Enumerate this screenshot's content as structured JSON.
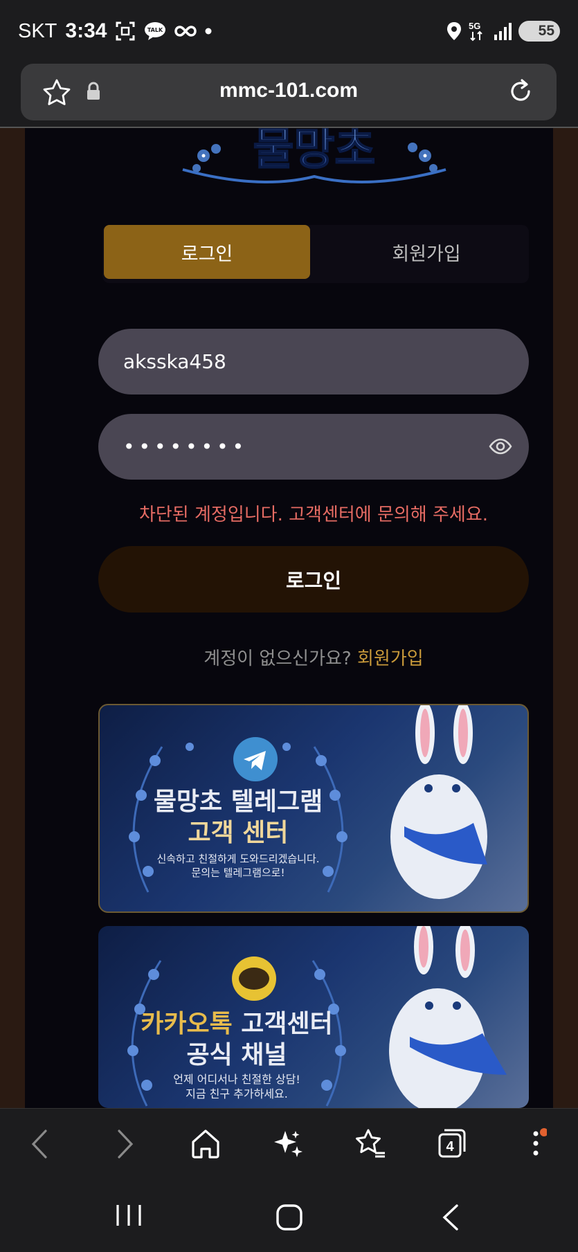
{
  "status_bar": {
    "carrier": "SKT",
    "time": "3:34",
    "network": "5G",
    "battery": "55"
  },
  "browser": {
    "url": "mmc-101.com",
    "tab_count": "4"
  },
  "page": {
    "logo_text": "물망초",
    "tabs": {
      "login": "로그인",
      "signup": "회원가입"
    },
    "username_value": "aksska458",
    "password_mask": "••••••••",
    "error_message": "차단된 계정입니다. 고객센터에 문의해 주세요.",
    "login_button": "로그인",
    "no_account_text": "계정이 없으신가요?",
    "signup_link": "회원가입"
  },
  "banners": {
    "telegram": {
      "icon": "telegram-icon",
      "title_line1": "물망초 텔레그램",
      "title_line2": "고객 센터",
      "sub_line1": "신속하고 친절하게 도와드리겠습니다.",
      "sub_line2": "문의는 텔레그램으로!"
    },
    "kakao": {
      "icon_label": "TALK",
      "title_gold": "카카오톡",
      "title_rest": " 고객센터",
      "title_line2": "공식 채널",
      "sub_line1": "언제 어디서나 친절한 상담!",
      "sub_line2": "지금 친구 추가하세요."
    }
  },
  "colors": {
    "accent_gold": "#8c6317",
    "error_red": "#e56b63",
    "link_gold": "#c99a3a"
  }
}
